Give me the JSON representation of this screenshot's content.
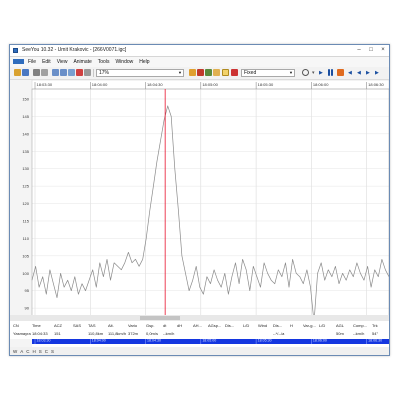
{
  "window": {
    "title": "SeeYou 10.32 - Umit Krakovic - [266V0071.igc]"
  },
  "menu": {
    "items": [
      "File",
      "Edit",
      "View",
      "Animate",
      "Tools",
      "Window",
      "Help"
    ]
  },
  "toolbar": {
    "zoom_value": "17%",
    "mode_value": "Fixed",
    "buttons": [
      "open-icon",
      "save-icon",
      "print-icon",
      "copy-icon",
      "zoom-in-icon",
      "zoom-out-icon",
      "zoom-fit-icon",
      "flag-icon",
      "pan-icon",
      "layers-icon",
      "chart-icon",
      "settings-icon",
      "clock-icon",
      "play-icon",
      "pause-icon",
      "stop-icon",
      "back-icon",
      "forward-icon"
    ]
  },
  "chart_data": {
    "type": "line",
    "title": "",
    "xlabel": "",
    "ylabel": "",
    "x_ticks": [
      "18:03:30",
      "18:04:00",
      "18:04:30",
      "18:05:00",
      "18:05:30",
      "18:06:00",
      "18:06:30"
    ],
    "bottom_ticks": [
      "18:03:30",
      "18:04:00",
      "18:04:30",
      "18:05:00",
      "18:05:30",
      "18:06:00",
      "18:06:30"
    ],
    "y_ticks": [
      150,
      145,
      140,
      135,
      130,
      125,
      120,
      115,
      110,
      105,
      100,
      95,
      90,
      85
    ],
    "ylim": [
      82,
      152
    ],
    "xlim": [
      0,
      100
    ],
    "cursor_x": 37.3,
    "cursor_color": "#e8112d",
    "series_color": "#8a8a8a",
    "band_color": "#1436e0",
    "series": [
      {
        "x": [
          0,
          1,
          2,
          3,
          4,
          5,
          6,
          7,
          8,
          9,
          10,
          11,
          12,
          13,
          14,
          15,
          16,
          17,
          18,
          19,
          20,
          21,
          22,
          23,
          24,
          25,
          26,
          27,
          28,
          29,
          30,
          31,
          32,
          33,
          34,
          35,
          36,
          37,
          38,
          39,
          40,
          41,
          42,
          43,
          44,
          45,
          46,
          47,
          48,
          49,
          50,
          51,
          52,
          53,
          54,
          55,
          56,
          57,
          58,
          59,
          60,
          61,
          62,
          63,
          64,
          65,
          66,
          67,
          68,
          69,
          70,
          71,
          72,
          73,
          74,
          75,
          76,
          77,
          78,
          79,
          80,
          81,
          82,
          83,
          84,
          85,
          86,
          87,
          88,
          89,
          90,
          91,
          92,
          93,
          94,
          95,
          96,
          97,
          98,
          99,
          100
        ],
        "values": [
          98,
          102,
          96,
          99,
          94,
          101,
          97,
          93,
          100,
          96,
          98,
          95,
          99,
          94,
          97,
          95,
          98,
          101,
          96,
          103,
          99,
          104,
          98,
          103,
          102,
          101,
          103,
          106,
          103,
          104,
          102,
          104,
          110,
          118,
          125,
          132,
          138,
          144,
          148,
          145,
          130,
          118,
          105,
          100,
          95,
          98,
          102,
          96,
          94,
          99,
          97,
          101,
          98,
          96,
          100,
          94,
          99,
          103,
          97,
          104,
          101,
          95,
          102,
          99,
          96,
          103,
          100,
          98,
          97,
          101,
          99,
          103,
          96,
          104,
          100,
          99,
          97,
          101,
          96,
          86,
          100,
          103,
          98,
          101,
          99,
          102,
          97,
          100,
          98,
          101,
          99,
          103,
          100,
          98,
          102,
          96,
          101,
          99,
          104,
          101,
          99
        ]
      }
    ]
  },
  "data_table": {
    "headers": [
      "CN",
      "Time",
      "ACZ",
      "SAS",
      "TAS",
      "Alt.",
      "Vario",
      "Gsp.",
      "dt",
      "dH",
      "AH...",
      "AGsp...",
      "Dis...",
      "L/D",
      "Wind",
      "Dis...",
      "H",
      "Var-g...",
      "L/D",
      "AGL",
      "Comp...",
      "Trk"
    ],
    "values": [
      "Yasmayra",
      "18:04:33",
      "151",
      "",
      "110,8km",
      "111,8km/h",
      "372m",
      "0,0m/s",
      "--km/h",
      "",
      "",
      "",
      "",
      "",
      "",
      "--*/--/a",
      "",
      "",
      "",
      "50m",
      "--km/h",
      "54°"
    ]
  },
  "status_bar": {
    "items": [
      "W",
      "A",
      "C",
      "H",
      "S",
      "C",
      "S"
    ]
  }
}
